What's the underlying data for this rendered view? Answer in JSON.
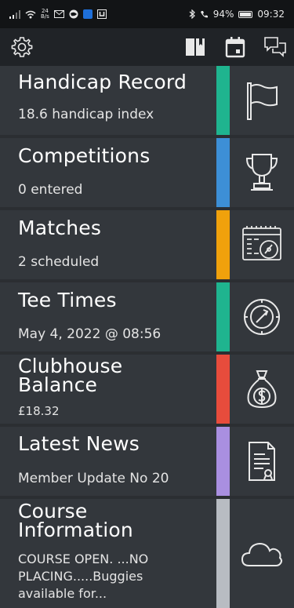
{
  "status_bar": {
    "network": "24",
    "network_unit": "B/s",
    "battery": "94%",
    "time": "09:32",
    "icons": [
      "signal-icon",
      "wifi-icon",
      "mail-icon",
      "globe-icon",
      "app-icon",
      "bluetooth-icon",
      "call-icon",
      "battery-icon"
    ]
  },
  "toolbar": {
    "icons": [
      "gear-icon",
      "book-icon",
      "calendar-icon",
      "chat-icon"
    ]
  },
  "tiles": [
    {
      "title": "Handicap Record",
      "subtitle": "18.6 handicap index",
      "color": "#1fb48f",
      "icon": "flag-icon"
    },
    {
      "title": "Competitions",
      "subtitle": "0 entered",
      "color": "#3d8fd6",
      "icon": "trophy-icon"
    },
    {
      "title": "Matches",
      "subtitle": "2 scheduled",
      "color": "#f0a10c",
      "icon": "calendar-golf-icon"
    },
    {
      "title": "Tee Times",
      "subtitle": "May 4, 2022 @ 08:56",
      "color": "#1fb48f",
      "icon": "clock-icon"
    },
    {
      "title_line1": "Clubhouse",
      "title_line2": "Balance",
      "subtitle": "£18.32",
      "color": "#e74c3c",
      "icon": "money-bag-icon"
    },
    {
      "title": "Latest News",
      "subtitle": "Member Update No 20",
      "color": "#a98fe0",
      "icon": "document-icon"
    },
    {
      "title_line1": "Course",
      "title_line2": "Information",
      "sub_line1": "COURSE OPEN. ...NO",
      "sub_line2": "PLACING.....Buggies",
      "sub_line3": "available for...",
      "color": "#b8bcc2",
      "icon": "cloud-icon"
    }
  ]
}
